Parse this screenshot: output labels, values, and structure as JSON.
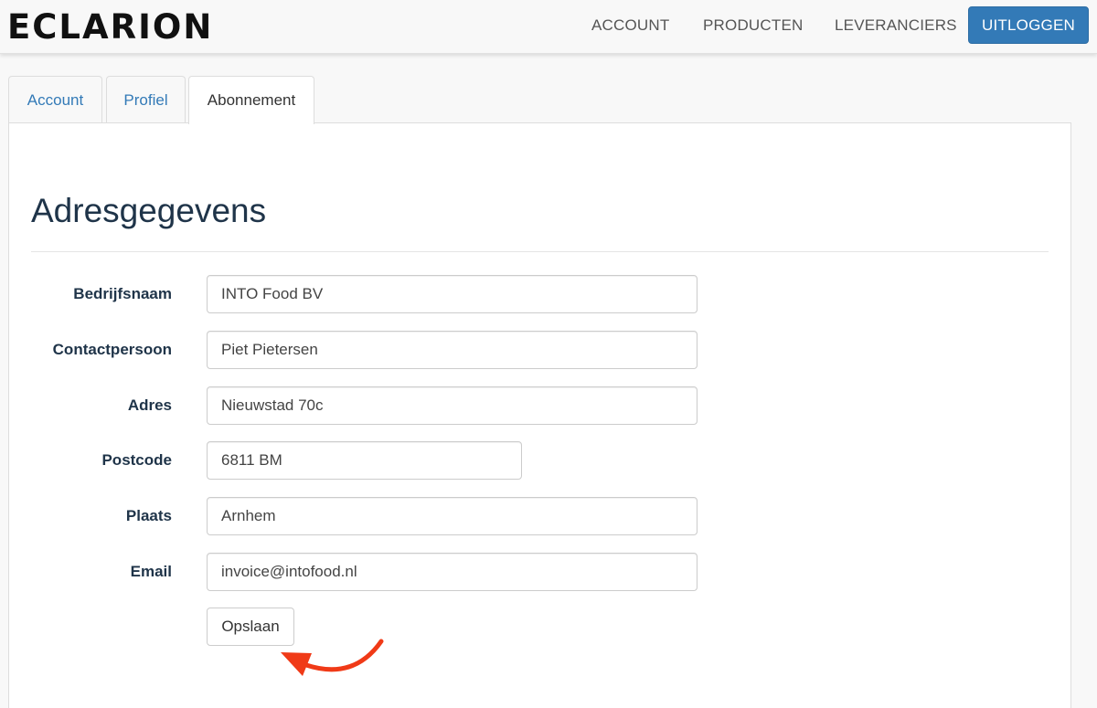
{
  "navbar": {
    "brand": "ECLARION",
    "links": [
      "ACCOUNT",
      "PRODUCTEN",
      "LEVERANCIERS"
    ],
    "logout_label": "UITLOGGEN",
    "accent": "#337ab7"
  },
  "tabs": [
    {
      "label": "Account",
      "active": false
    },
    {
      "label": "Profiel",
      "active": false
    },
    {
      "label": "Abonnement",
      "active": true
    }
  ],
  "form": {
    "title": "Adresgegevens",
    "fields": [
      {
        "label": "Bedrijfsnaam",
        "value": "INTO Food BV"
      },
      {
        "label": "Contactpersoon",
        "value": "Piet Pietersen"
      },
      {
        "label": "Adres",
        "value": "Nieuwstad 70c"
      },
      {
        "label": "Postcode",
        "value": "6811 BM"
      },
      {
        "label": "Plaats",
        "value": "Arnhem"
      },
      {
        "label": "Email",
        "value": "invoice@intofood.nl"
      }
    ],
    "save_label": "Opslaan"
  },
  "annotation": {
    "icon": "curved-arrow-icon",
    "color": "#f03a17"
  }
}
